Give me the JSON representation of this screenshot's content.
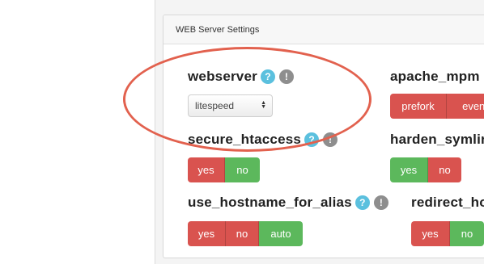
{
  "panel": {
    "title": "WEB Server Settings"
  },
  "settings": {
    "webserver": {
      "label": "webserver",
      "help_glyph": "?",
      "info_glyph": "!",
      "select_value": "litespeed"
    },
    "apache_mpm": {
      "label": "apache_mpm",
      "buttons": [
        "prefork",
        "event"
      ]
    },
    "secure_htaccess": {
      "label": "secure_htaccess",
      "help_glyph": "?",
      "info_glyph": "!",
      "buttons": [
        "yes",
        "no"
      ]
    },
    "harden_symlinks": {
      "label": "harden_symlin",
      "buttons": [
        "yes",
        "no"
      ]
    },
    "use_hostname_for_alias": {
      "label": "use_hostname_for_alias",
      "help_glyph": "?",
      "info_glyph": "!",
      "buttons": [
        "yes",
        "no",
        "auto"
      ]
    },
    "redirect_ho": {
      "label": "redirect_ho",
      "buttons": [
        "yes",
        "no"
      ]
    }
  },
  "colors": {
    "btn_red": "#d9534f",
    "btn_green": "#5cb85c",
    "help_icon": "#5bc0de",
    "info_icon": "#8e8e8e",
    "annotation_ellipse": "#e2614e"
  },
  "icons": {
    "help": "question-circle-icon",
    "info": "exclamation-circle-icon",
    "select_caret": "up-down-caret-icon"
  }
}
